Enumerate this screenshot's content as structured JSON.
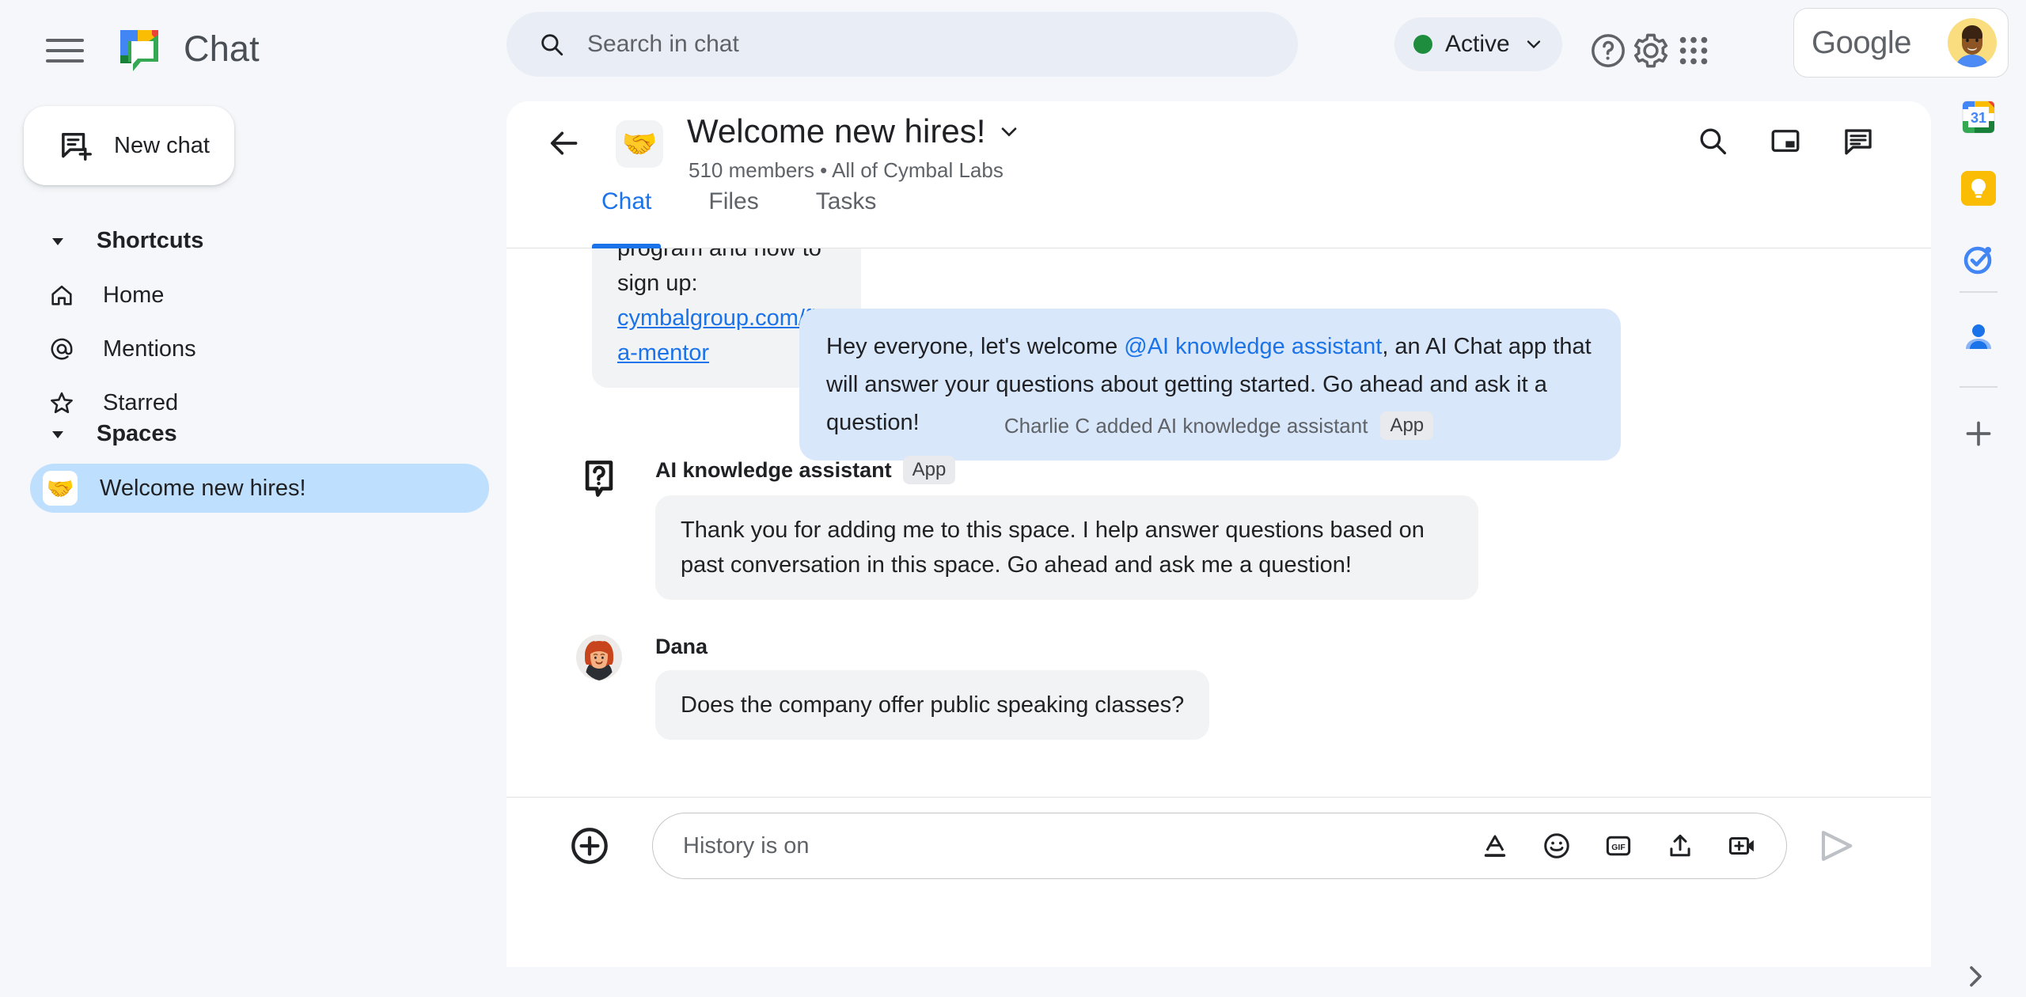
{
  "app": {
    "brand": "Chat",
    "logo_icon": "google-chat-logo-icon",
    "menu_icon": "hamburger-menu-icon"
  },
  "search": {
    "placeholder": "Search in chat",
    "value": "",
    "icon": "search-icon"
  },
  "header": {
    "status": {
      "label": "Active",
      "dot_color": "#1e8e3e",
      "chevron_icon": "chevron-down-icon"
    },
    "help_icon": "help-circle-icon",
    "settings_icon": "gear-icon",
    "apps_icon": "apps-grid-icon",
    "account": {
      "brand": "Google",
      "avatar_icon": "user-avatar"
    }
  },
  "sidebar": {
    "new_chat": {
      "label": "New chat",
      "icon": "new-chat-icon"
    },
    "shortcuts": {
      "title": "Shortcuts",
      "caret_icon": "caret-down-icon",
      "items": [
        {
          "label": "Home",
          "icon": "home-icon"
        },
        {
          "label": "Mentions",
          "icon": "at-mention-icon"
        },
        {
          "label": "Starred",
          "icon": "star-icon"
        }
      ]
    },
    "spaces": {
      "title": "Spaces",
      "caret_icon": "caret-down-icon",
      "items": [
        {
          "label": "Welcome new hires!",
          "emoji": "🤝",
          "selected": true
        }
      ]
    }
  },
  "conversation": {
    "back_icon": "back-arrow-icon",
    "emoji": "🤝",
    "title": "Welcome new hires!",
    "title_chevron_icon": "chevron-down-icon",
    "subtitle": "510 members  •  All of Cymbal Labs",
    "actions": [
      {
        "icon": "search-icon"
      },
      {
        "icon": "picture-in-picture-icon"
      },
      {
        "icon": "conversation-icon"
      }
    ],
    "tabs": [
      {
        "label": "Chat",
        "active": true
      },
      {
        "label": "Files",
        "active": false
      },
      {
        "label": "Tasks",
        "active": false
      }
    ]
  },
  "messages": {
    "partial": {
      "text": "program and how to sign up:",
      "link": "cymbalgroup.com/find-a-mentor"
    },
    "outgoing": {
      "prefix": "Hey everyone, let's welcome ",
      "mention": "@AI knowledge assistant",
      "suffix": ", an AI Chat app that will answer your questions about getting started.  Go ahead and ask it a question!"
    },
    "system": {
      "text": "Charlie C added AI knowledge assistant",
      "badge": "App"
    },
    "assistant": {
      "name": "AI knowledge assistant",
      "badge": "App",
      "avatar_icon": "question-bubble-icon",
      "text": "Thank you for adding me to this space. I help answer questions based on past conversation in this space. Go ahead and ask me a question!"
    },
    "dana": {
      "name": "Dana",
      "avatar_icon": "dana-avatar",
      "text": "Does the company offer public speaking classes?"
    }
  },
  "composer": {
    "plus_icon": "add-circle-icon",
    "placeholder": "History is on",
    "value": "",
    "tools": [
      {
        "icon": "format-text-icon"
      },
      {
        "icon": "emoji-icon"
      },
      {
        "icon": "gif-icon"
      },
      {
        "icon": "upload-icon"
      },
      {
        "icon": "add-video-icon"
      }
    ],
    "send_icon": "send-icon"
  },
  "rail": {
    "items": [
      {
        "icon": "google-calendar-icon",
        "label": "31"
      },
      {
        "icon": "google-keep-icon"
      },
      {
        "icon": "google-tasks-icon"
      },
      {
        "icon": "google-contacts-icon"
      },
      {
        "icon": "add-icon"
      }
    ],
    "expand_icon": "chevron-right-icon"
  }
}
